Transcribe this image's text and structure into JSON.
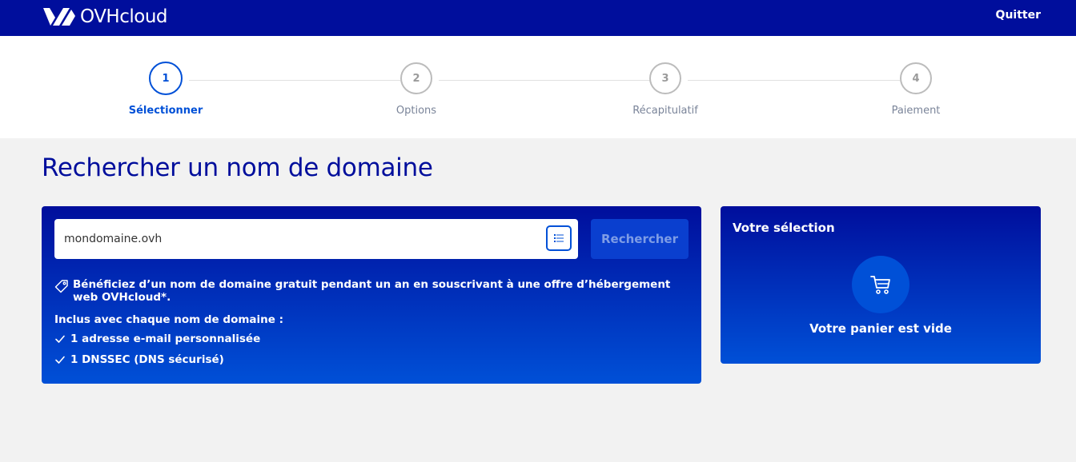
{
  "header": {
    "brand": "OVHcloud",
    "quit_label": "Quitter",
    "bg_color": "#000e9c"
  },
  "stepper": {
    "steps": [
      {
        "number": "1",
        "label": "Sélectionner",
        "active": true
      },
      {
        "number": "2",
        "label": "Options",
        "active": false
      },
      {
        "number": "3",
        "label": "Récapitulatif",
        "active": false
      },
      {
        "number": "4",
        "label": "Paiement",
        "active": false
      }
    ],
    "active_color": "#0050d7"
  },
  "main": {
    "title": "Rechercher un nom de domaine",
    "search": {
      "value": "mondomaine.ovh",
      "button_label": "Rechercher",
      "list_icon": "list-icon"
    },
    "promo": {
      "icon": "tag-icon",
      "text": "Bénéficiez d’un nom de domaine gratuit pendant un an en souscrivant à une offre d’hébergement web OVHcloud*."
    },
    "included": {
      "title": "Inclus avec chaque nom de domaine :",
      "items": [
        "1 adresse e-mail personnalisée",
        "1 DNSSEC (DNS sécurisé)"
      ]
    }
  },
  "selection": {
    "title": "Votre sélection",
    "cart_icon": "cart-icon",
    "empty_text": "Votre panier est vide"
  }
}
